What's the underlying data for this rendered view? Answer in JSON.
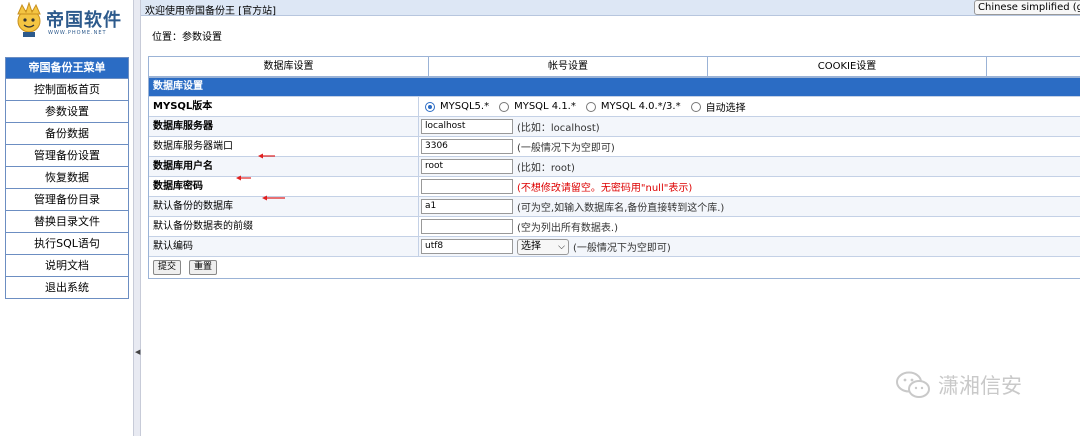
{
  "topbar": {
    "title": "欢迎使用帝国备份王 [官方站]",
    "language": "Chinese simplified (gb23"
  },
  "logo": {
    "name": "帝国软件",
    "sub": "WWW.PHOME.NET"
  },
  "menu": {
    "title": "帝国备份王菜单",
    "items": [
      "控制面板首页",
      "参数设置",
      "备份数据",
      "管理备份设置",
      "恢复数据",
      "管理备份目录",
      "替换目录文件",
      "执行SQL语句",
      "说明文档",
      "退出系统"
    ]
  },
  "breadcrumb": "位置：参数设置",
  "tabs": [
    "数据库设置",
    "帐号设置",
    "COOKIE设置",
    ""
  ],
  "form": {
    "section_title": "数据库设置",
    "mysql_version": {
      "label": "MYSQL版本",
      "options": [
        "MYSQL5.*",
        "MYSQL 4.1.*",
        "MYSQL 4.0.*/3.*",
        "自动选择"
      ],
      "selected": "MYSQL5.*"
    },
    "db_server": {
      "label": "数据库服务器",
      "value": "localhost",
      "hint": "(比如：localhost)"
    },
    "db_port": {
      "label": "数据库服务器端口",
      "value": "3306",
      "hint": "(一般情况下为空即可)"
    },
    "db_user": {
      "label": "数据库用户名",
      "value": "root",
      "hint": "(比如：root)"
    },
    "db_password": {
      "label": "数据库密码",
      "value": "",
      "hint": "(不想修改请留空。无密码用\"null\"表示)"
    },
    "default_db": {
      "label": "默认备份的数据库",
      "value": "a1",
      "hint": "(可为空,如输入数据库名,备份直接转到这个库.)"
    },
    "table_prefix": {
      "label": "默认备份数据表的前缀",
      "value": "",
      "hint": "(空为列出所有数据表.)"
    },
    "charset": {
      "label": "默认编码",
      "value": "utf8",
      "select_label": "选择",
      "hint": "(一般情况下为空即可)"
    },
    "submit_label": "提交",
    "reset_label": "重置"
  },
  "watermark": "潇湘信安",
  "colors": {
    "accent": "#2b6cc4",
    "hint_red": "#dd0000",
    "arrow_red": "#e02020"
  }
}
